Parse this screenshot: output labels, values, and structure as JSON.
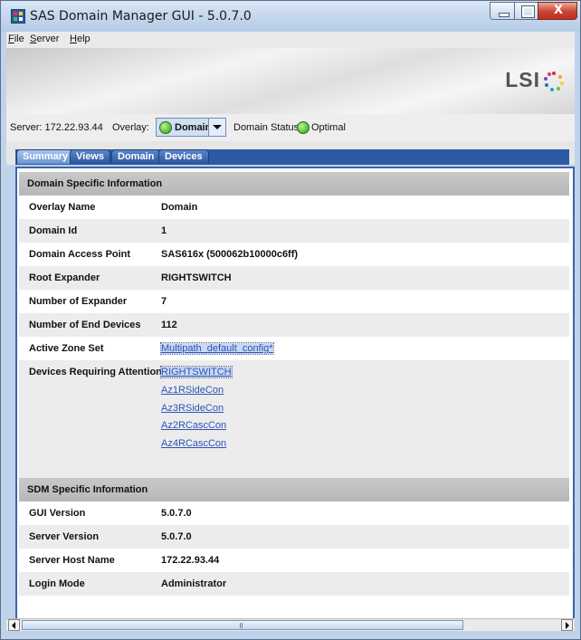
{
  "window": {
    "title": "SAS Domain Manager GUI - 5.0.7.0",
    "close_glyph": "X"
  },
  "menu": [
    {
      "mnemonic": "F",
      "rest": "ile"
    },
    {
      "mnemonic": "S",
      "rest": "erver"
    },
    {
      "mnemonic": "H",
      "rest": "elp"
    }
  ],
  "banner": {
    "logo_text": "LSI"
  },
  "serverbar": {
    "server_label": "Server: 172.22.93.44",
    "overlay_label": "Overlay:",
    "overlay_value": "Domain",
    "status_label": "Domain Status:",
    "status_value": "Optimal",
    "status_color": "#3fb52a"
  },
  "tabs": [
    "Summary",
    "Views",
    "Domain",
    "Devices"
  ],
  "active_tab": "Summary",
  "domain_section": {
    "title": "Domain Specific Information",
    "overlay_name": {
      "label": "Overlay Name",
      "value": "Domain"
    },
    "domain_id": {
      "label": "Domain Id",
      "value": "1"
    },
    "access_point": {
      "label": "Domain Access Point",
      "value": "SAS616x (500062b10000c6ff)"
    },
    "root_expander": {
      "label": "Root Expander",
      "value": "RIGHTSWITCH"
    },
    "num_expander": {
      "label": "Number of Expander",
      "value": "7"
    },
    "num_end_devices": {
      "label": "Number of End Devices",
      "value": "112"
    },
    "active_zone_set": {
      "label": "Active Zone Set",
      "value": "Multipath_default_config*"
    },
    "attention": {
      "label": "Devices Requiring Attention",
      "devices": [
        "RIGHTSWITCH",
        "Az1RSideCon",
        "Az3RSideCon",
        "Az2RCascCon",
        "Az4RCascCon"
      ]
    }
  },
  "sdm_section": {
    "title": "SDM Specific Information",
    "gui_version": {
      "label": "GUI Version",
      "value": "5.0.7.0"
    },
    "server_version": {
      "label": "Server Version",
      "value": "5.0.7.0"
    },
    "host_name": {
      "label": "Server Host Name",
      "value": "172.22.93.44"
    },
    "login_mode": {
      "label": "Login Mode",
      "value": "Administrator"
    }
  }
}
